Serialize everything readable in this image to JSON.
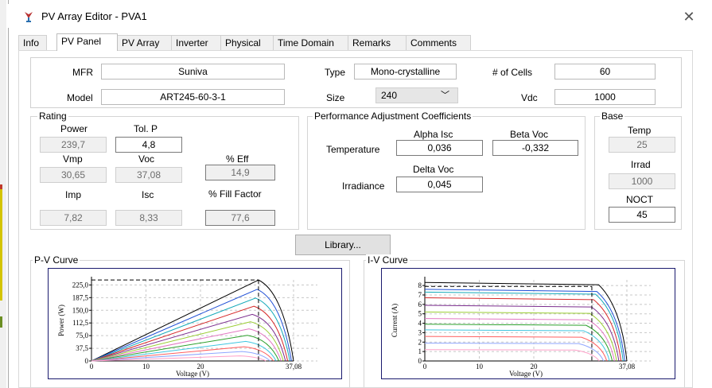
{
  "window": {
    "title": "PV Array Editor - PVA1",
    "close_glyph": "✕"
  },
  "tabs": [
    "Info",
    "PV Panel",
    "PV Array",
    "Inverter",
    "Physical",
    "Time Domain",
    "Remarks",
    "Comments"
  ],
  "active_tab": "PV Panel",
  "header": {
    "mfr_label": "MFR",
    "mfr_value": "Suniva",
    "type_label": "Type",
    "type_value": "Mono-crystalline",
    "cells_label": "# of Cells",
    "cells_value": "60",
    "model_label": "Model",
    "model_value": "ART245-60-3-1",
    "size_label": "Size",
    "size_value": "240",
    "size_chevron": "﹀",
    "vdc_label": "Vdc",
    "vdc_value": "1000"
  },
  "rating": {
    "title": "Rating",
    "power_label": "Power",
    "power_value": "239,7",
    "tolp_label": "Tol. P",
    "tolp_value": "4,8",
    "vmp_label": "Vmp",
    "vmp_value": "30,65",
    "voc_label": "Voc",
    "voc_value": "37,08",
    "eff_label": "% Eff",
    "eff_value": "14,9",
    "imp_label": "Imp",
    "imp_value": "7,82",
    "isc_label": "Isc",
    "isc_value": "8,33",
    "fill_label": "% Fill Factor",
    "fill_value": "77,6"
  },
  "performance": {
    "title": "Performance Adjustment Coefficients",
    "alpha_label": "Alpha Isc",
    "beta_label": "Beta Voc",
    "temperature_label": "Temperature",
    "alpha_value": "0,036",
    "beta_value": "-0,332",
    "delta_label": "Delta Voc",
    "irradiance_label": "Irradiance",
    "delta_value": "0,045"
  },
  "base": {
    "title": "Base",
    "temp_label": "Temp",
    "temp_value": "25",
    "irrad_label": "Irrad",
    "irrad_value": "1000",
    "noct_label": "NOCT",
    "noct_value": "45"
  },
  "library_button": "Library...",
  "chart_data": [
    {
      "type": "line",
      "title": "P-V Curve",
      "xlabel": "Voltage (V)",
      "ylabel": "Power (W)",
      "xlim": [
        0,
        37.08
      ],
      "ylim": [
        0,
        240
      ],
      "xticks": [
        "0",
        "10",
        "20",
        "37,08"
      ],
      "yticks": [
        "0",
        "37,5",
        "75,0",
        "112,5",
        "150,0",
        "187,5",
        "225,0"
      ],
      "grid": true,
      "series": [
        {
          "color": "#000000",
          "values": [
            [
              0,
              0
            ],
            [
              30.65,
              239.7
            ],
            [
              37.08,
              0
            ]
          ]
        },
        {
          "color": "#1f4fd6",
          "values": [
            [
              0,
              0
            ],
            [
              30.4,
              212
            ],
            [
              36.7,
              0
            ]
          ]
        },
        {
          "color": "#11a8b8",
          "values": [
            [
              0,
              0
            ],
            [
              30.1,
              186
            ],
            [
              36.4,
              0
            ]
          ]
        },
        {
          "color": "#d62828",
          "values": [
            [
              0,
              0
            ],
            [
              29.8,
              162
            ],
            [
              36.0,
              0
            ]
          ]
        },
        {
          "color": "#7b2d8e",
          "values": [
            [
              0,
              0
            ],
            [
              29.5,
              138
            ],
            [
              35.6,
              0
            ]
          ]
        },
        {
          "color": "#9acd32",
          "values": [
            [
              0,
              0
            ],
            [
              29.2,
              116
            ],
            [
              35.2,
              0
            ]
          ]
        },
        {
          "color": "#e377c2",
          "values": [
            [
              0,
              0
            ],
            [
              28.9,
              95
            ],
            [
              34.8,
              0
            ]
          ]
        },
        {
          "color": "#2ca02c",
          "values": [
            [
              0,
              0
            ],
            [
              28.6,
              76
            ],
            [
              34.4,
              0
            ]
          ]
        },
        {
          "color": "#3fc6e0",
          "values": [
            [
              0,
              0
            ],
            [
              28.3,
              58
            ],
            [
              33.9,
              0
            ]
          ]
        },
        {
          "color": "#ff5f5f",
          "values": [
            [
              0,
              0
            ],
            [
              28.0,
              42
            ],
            [
              33.4,
              0
            ]
          ]
        },
        {
          "color": "#8fa6ff",
          "values": [
            [
              0,
              0
            ],
            [
              27.6,
              28
            ],
            [
              32.8,
              0
            ]
          ]
        },
        {
          "color": "#ffa0c8",
          "values": [
            [
              0,
              0
            ],
            [
              27.2,
              15
            ],
            [
              32.0,
              0
            ]
          ]
        }
      ]
    },
    {
      "type": "line",
      "title": "I-V Curve",
      "xlabel": "Voltage (V)",
      "ylabel": "Current (A)",
      "xlim": [
        0,
        37.08
      ],
      "ylim": [
        0,
        8.6
      ],
      "xticks": [
        "0",
        "10",
        "20",
        "37,08"
      ],
      "yticks": [
        "0",
        "1",
        "2",
        "3",
        "4",
        "5",
        "6",
        "7",
        "8"
      ],
      "grid": true,
      "series": [
        {
          "color": "#000000",
          "isc": 8.33,
          "voc": 37.08
        },
        {
          "color": "#1f4fd6",
          "isc": 7.6,
          "voc": 36.7
        },
        {
          "color": "#11a8b8",
          "isc": 7.3,
          "voc": 36.4
        },
        {
          "color": "#d62828",
          "isc": 6.7,
          "voc": 36.0
        },
        {
          "color": "#7b2d8e",
          "isc": 5.9,
          "voc": 35.6
        },
        {
          "color": "#9acd32",
          "isc": 5.2,
          "voc": 35.2
        },
        {
          "color": "#e377c2",
          "isc": 4.5,
          "voc": 34.8
        },
        {
          "color": "#2ca02c",
          "isc": 3.9,
          "voc": 34.4
        },
        {
          "color": "#3fc6e0",
          "isc": 3.3,
          "voc": 33.9
        },
        {
          "color": "#ff5f5f",
          "isc": 2.6,
          "voc": 33.4
        },
        {
          "color": "#8fa6ff",
          "isc": 1.9,
          "voc": 32.8
        },
        {
          "color": "#ffa0c8",
          "isc": 1.2,
          "voc": 32.0
        }
      ]
    }
  ]
}
